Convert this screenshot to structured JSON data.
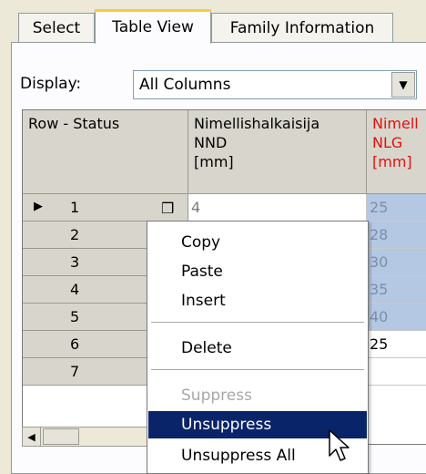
{
  "tabs": [
    {
      "label": "Select"
    },
    {
      "label": "Table View"
    },
    {
      "label": "Family Information"
    }
  ],
  "display": {
    "label": "Display:",
    "value": "All Columns"
  },
  "grid": {
    "headers": [
      {
        "lines": [
          "Row - Status"
        ]
      },
      {
        "lines": [
          "Nimellishalkaisija",
          "NND",
          "[mm]"
        ]
      },
      {
        "lines": [
          "Nimell",
          "NLG",
          "[mm]"
        ]
      }
    ],
    "rows": [
      {
        "num": "1",
        "c1": "4",
        "c2": "25"
      },
      {
        "num": "2",
        "c1": "",
        "c2": "28"
      },
      {
        "num": "3",
        "c1": "",
        "c2": "30"
      },
      {
        "num": "4",
        "c1": "",
        "c2": "35"
      },
      {
        "num": "5",
        "c1": "",
        "c2": "40"
      },
      {
        "num": "6",
        "c1": "",
        "c2": "25"
      },
      {
        "num": "7",
        "c1": "",
        "c2": ""
      }
    ]
  },
  "context_menu": {
    "items": [
      {
        "label": "Copy",
        "enabled": true
      },
      {
        "label": "Paste",
        "enabled": true
      },
      {
        "label": "Insert",
        "enabled": true
      },
      {
        "label": "Delete",
        "enabled": true
      },
      {
        "label": "Suppress",
        "enabled": false
      },
      {
        "label": "Unsuppress",
        "enabled": true,
        "highlighted": true
      },
      {
        "label": "Unsuppress All",
        "enabled": true
      }
    ]
  },
  "colors": {
    "highlight": "#0a246a",
    "selected_cells": "#b4c8e4",
    "red_header": "#e01010"
  }
}
